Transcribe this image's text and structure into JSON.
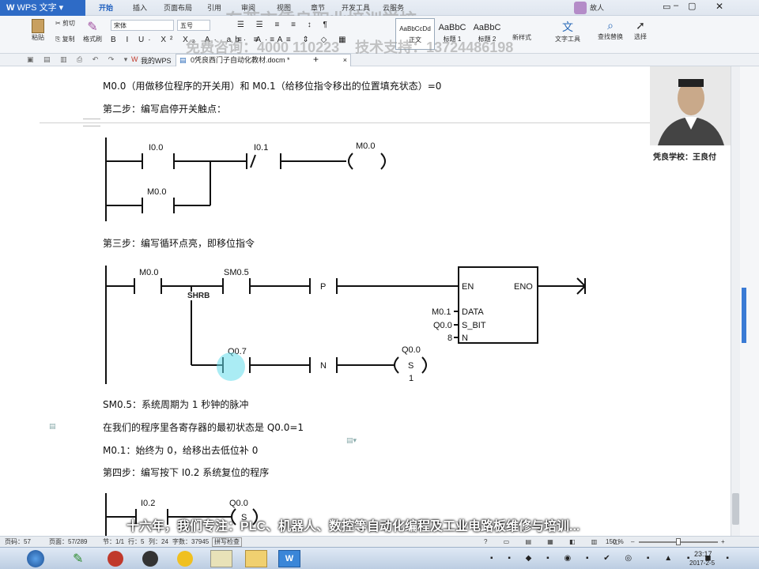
{
  "titlebar": {
    "app_name": "WPS 文字",
    "tabs": [
      "开始",
      "插入",
      "页面布局",
      "引用",
      "审阅",
      "视图",
      "章节",
      "开发工具",
      "云服务"
    ],
    "user": "故人"
  },
  "ribbon": {
    "paste": "粘贴",
    "cut": "剪切",
    "copy": "复制",
    "format_painter": "格式刷",
    "font_name": "宋体",
    "font_size": "五号",
    "styles": [
      {
        "preview": "AaBbCcDd",
        "label": "正文"
      },
      {
        "preview": "AaBbC",
        "label": "标题 1"
      },
      {
        "preview": "AaBbC",
        "label": "标题 2"
      }
    ],
    "new_style": "新样式",
    "text_tools": "文字工具",
    "find_replace": "查找替换",
    "select": "选择"
  },
  "quickbar": {
    "my_wps": "我的WPS",
    "doc_tab": "0凭良西门子自动化教材.docm *"
  },
  "watermark": {
    "line1": "东莞市凭良职业培训学校",
    "line2_a": "免费咨询：4000 110223",
    "line2_b": "技术支持：13724486198"
  },
  "presenter": {
    "caption": "凭良学校：王良付"
  },
  "document": {
    "line1": "M0.0（用做移位程序的开关用）和 M0.1（给移位指令移出的位置填充状态）=0",
    "step2": "第二步：编写启停开关触点：",
    "step3": "第三步：编写循环点亮，即移位指令",
    "note1": "SM0.5：系统周期为 1 秒钟的脉冲",
    "note2": "在我们的程序里各寄存器的最初状态是 Q0.0=1",
    "note3": "M0.1：始终为 0，给移出去低位补 0",
    "step4": "第四步：编写按下 I0.2 系统复位的程序"
  },
  "ladder1": {
    "c1": "I0.0",
    "c2": "I0.1",
    "coil": "M0.0",
    "c3": "M0.0",
    "nc": "/"
  },
  "ladder2": {
    "c1": "M0.0",
    "c2": "SM0.5",
    "p": "P",
    "block": "SHRB",
    "en": "EN",
    "eno": "ENO",
    "data": "DATA",
    "sbit": "S_BIT",
    "n": "N",
    "data_val": "M0.1",
    "sbit_val": "Q0.0",
    "n_val": "8",
    "c3": "Q0.7",
    "nn": "N",
    "coil": "Q0.0",
    "coil_type": "S",
    "coil_n": "1"
  },
  "ladder3": {
    "c1": "I0.2",
    "coil": "Q0.0",
    "coil_type": "S"
  },
  "subtitle": "十六年，我们专注：PLC、机器人、数控等自动化编程及工业电路板维修与培训...",
  "statusbar": {
    "page_no": "页码：57",
    "pages": "页面：57/289",
    "section": "节：1/1",
    "row": "行：5",
    "col": "列：24",
    "words": "字数：37945",
    "spell": "拼写检查",
    "zoom": "150 %"
  },
  "taskbar": {
    "time": "23:17",
    "date": "2017-2-5"
  }
}
